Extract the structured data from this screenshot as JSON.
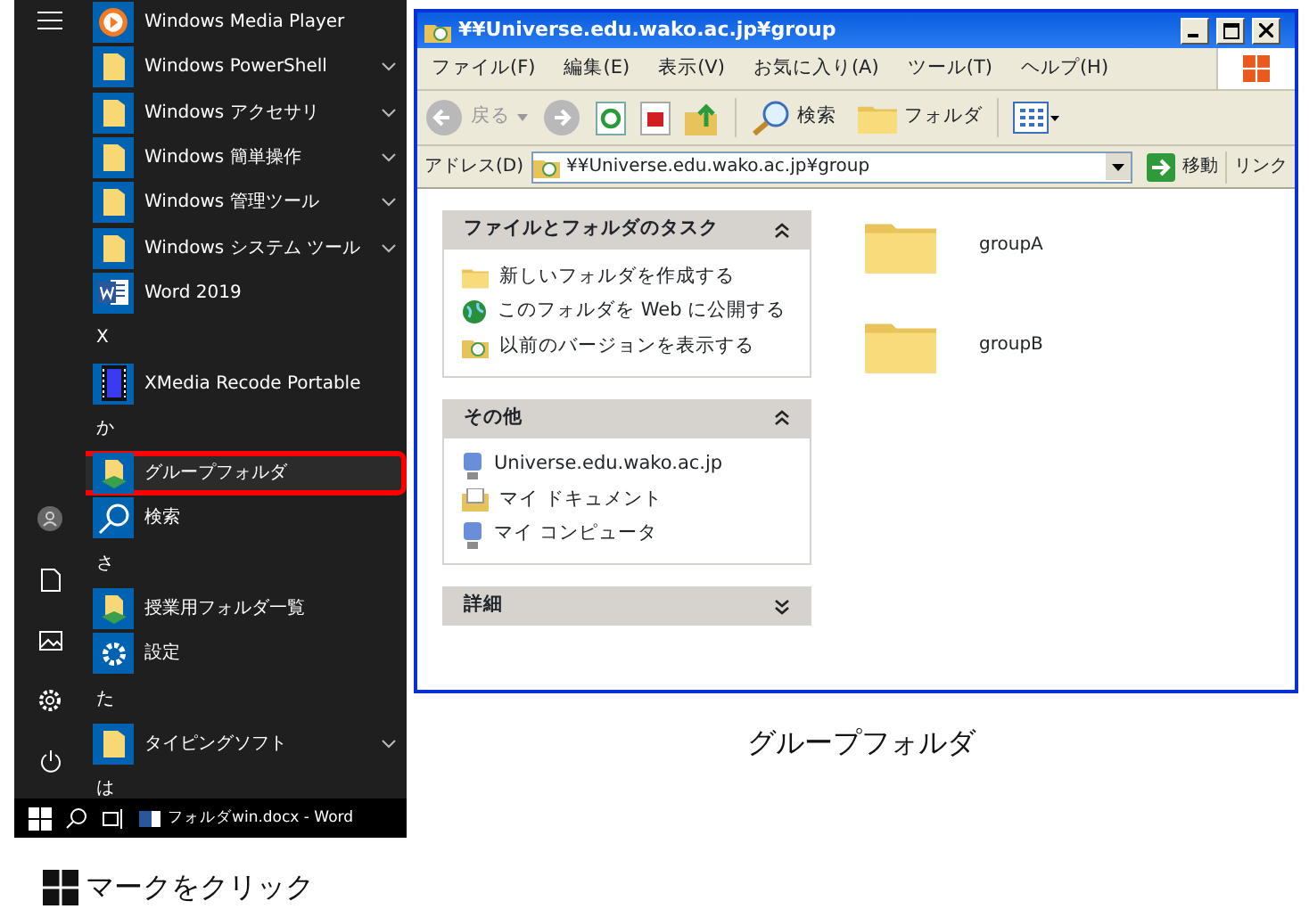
{
  "start_menu": {
    "items": [
      {
        "kind": "media",
        "label": "Windows Media Player",
        "expandable": false,
        "selected": false
      },
      {
        "kind": "folder",
        "label": "Windows PowerShell",
        "expandable": true,
        "selected": false
      },
      {
        "kind": "folder",
        "label": "Windows アクセサリ",
        "expandable": true,
        "selected": false
      },
      {
        "kind": "folder",
        "label": "Windows 簡単操作",
        "expandable": true,
        "selected": false
      },
      {
        "kind": "folder",
        "label": "Windows 管理ツール",
        "expandable": true,
        "selected": false
      },
      {
        "kind": "folder",
        "label": "Windows システム ツール",
        "expandable": true,
        "selected": false
      },
      {
        "kind": "word",
        "label": "Word 2019",
        "expandable": false,
        "selected": false
      },
      {
        "kind": "header",
        "label": "X"
      },
      {
        "kind": "film",
        "label": "XMedia Recode Portable",
        "expandable": false,
        "selected": false
      },
      {
        "kind": "header",
        "label": "か"
      },
      {
        "kind": "share",
        "label": "グループフォルダ",
        "expandable": false,
        "selected": true
      },
      {
        "kind": "search",
        "label": "検索",
        "expandable": false,
        "selected": false
      },
      {
        "kind": "header",
        "label": "さ"
      },
      {
        "kind": "share",
        "label": "授業用フォルダ一覧",
        "expandable": false,
        "selected": false
      },
      {
        "kind": "gear",
        "label": "設定",
        "expandable": false,
        "selected": false
      },
      {
        "kind": "header",
        "label": "た"
      },
      {
        "kind": "folder",
        "label": "タイピングソフト",
        "expandable": true,
        "selected": false
      },
      {
        "kind": "header",
        "label": "は"
      }
    ]
  },
  "taskbar": {
    "document_title": "フォルダwin.docx - Word"
  },
  "start_caption": "マークをクリック",
  "explorer": {
    "title": "¥¥Universe.edu.wako.ac.jp¥group",
    "menu": [
      "ファイル(F)",
      "編集(E)",
      "表示(V)",
      "お気に入り(A)",
      "ツール(T)",
      "ヘルプ(H)"
    ],
    "toolbar": {
      "back": "戻る",
      "search": "検索",
      "folders": "フォルダ"
    },
    "address": {
      "label": "アドレス(D)",
      "value": "¥¥Universe.edu.wako.ac.jp¥group",
      "go": "移動",
      "links": "リンク"
    },
    "task_panels": [
      {
        "title": "ファイルとフォルダのタスク",
        "expanded": true,
        "items": [
          {
            "kind": "new-folder",
            "label": "新しいフォルダを作成する"
          },
          {
            "kind": "globe",
            "label": "このフォルダを Web に公開する"
          },
          {
            "kind": "history",
            "label": "以前のバージョンを表示する"
          }
        ]
      },
      {
        "title": "その他",
        "expanded": true,
        "items": [
          {
            "kind": "computer",
            "label": "Universe.edu.wako.ac.jp"
          },
          {
            "kind": "documents",
            "label": "マイ ドキュメント"
          },
          {
            "kind": "computer",
            "label": "マイ コンピュータ"
          }
        ]
      },
      {
        "title": "詳細",
        "expanded": false
      }
    ],
    "folders": [
      {
        "name": "groupA"
      },
      {
        "name": "groupB"
      }
    ]
  },
  "explorer_caption": "グループフォルダ"
}
